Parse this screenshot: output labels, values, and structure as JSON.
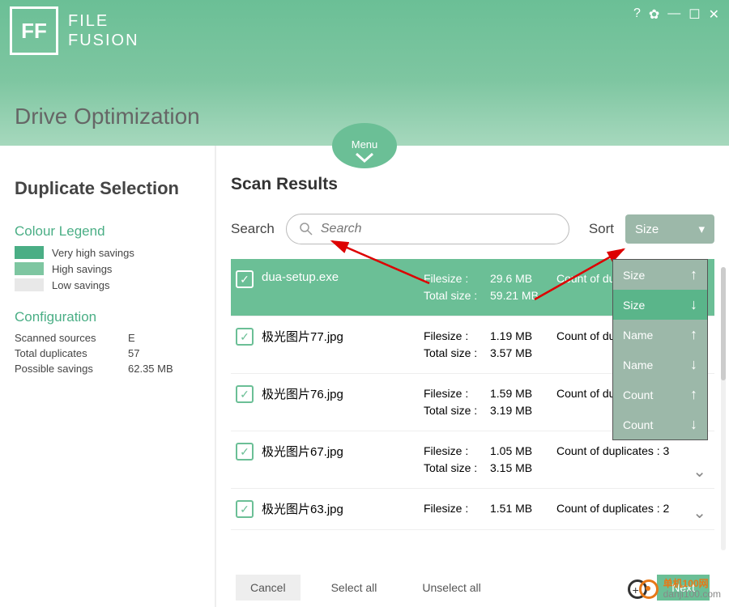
{
  "app": {
    "logo_initials": "FF",
    "name_line1": "FILE",
    "name_line2": "FUSION"
  },
  "page_title": "Drive Optimization",
  "menu_label": "Menu",
  "sidebar": {
    "title": "Duplicate Selection",
    "legend_title": "Colour Legend",
    "legend": [
      {
        "label": "Very high savings"
      },
      {
        "label": "High savings"
      },
      {
        "label": "Low savings"
      }
    ],
    "config_title": "Configuration",
    "config": [
      {
        "k": "Scanned sources",
        "v": "E"
      },
      {
        "k": "Total duplicates",
        "v": "57"
      },
      {
        "k": "Possible savings",
        "v": "62.35 MB"
      }
    ]
  },
  "main": {
    "title": "Scan Results",
    "search_label": "Search",
    "search_placeholder": "Search",
    "sort_label": "Sort",
    "sort_value": "Size"
  },
  "sort_options": [
    {
      "label": "Size",
      "dir": "up"
    },
    {
      "label": "Size",
      "dir": "down",
      "active": true
    },
    {
      "label": "Name",
      "dir": "up"
    },
    {
      "label": "Name",
      "dir": "down"
    },
    {
      "label": "Count",
      "dir": "up"
    },
    {
      "label": "Count",
      "dir": "down"
    }
  ],
  "rows": [
    {
      "name": "dua-setup.exe",
      "filesize": "29.6 MB",
      "total": "59.21 MB",
      "count": "Count of dup",
      "selected": true
    },
    {
      "name": "极光图片77.jpg",
      "filesize": "1.19 MB",
      "total": "3.57 MB",
      "count": "Count of dup"
    },
    {
      "name": "极光图片76.jpg",
      "filesize": "1.59 MB",
      "total": "3.19 MB",
      "count": "Count of dup"
    },
    {
      "name": "极光图片67.jpg",
      "filesize": "1.05 MB",
      "total": "3.15 MB",
      "count": "Count of duplicates : 3"
    },
    {
      "name": "极光图片63.jpg",
      "filesize": "1.51 MB",
      "total": "",
      "count": "Count of duplicates : 2"
    }
  ],
  "footer": {
    "cancel": "Cancel",
    "select_all": "Select all",
    "unselect_all": "Unselect all",
    "next": "Next"
  },
  "labels": {
    "filesize": "Filesize :",
    "totalsize": "Total size :"
  },
  "watermark": {
    "line1": "单机100网",
    "line2": "danji100.com"
  }
}
